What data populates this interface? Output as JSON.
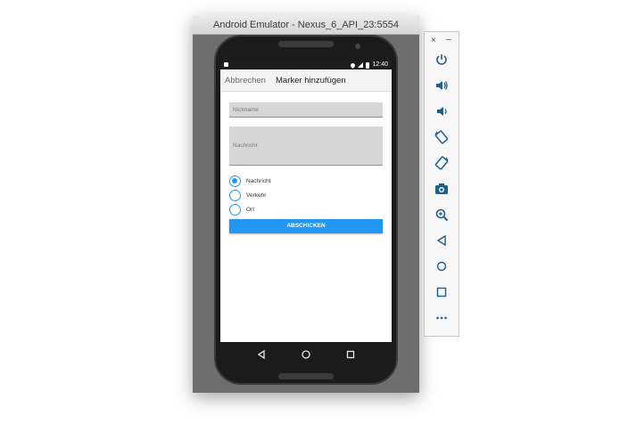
{
  "window": {
    "title": "Android Emulator - Nexus_6_API_23:5554"
  },
  "status_bar": {
    "time": "12:40"
  },
  "app_bar": {
    "cancel_label": "Abbrechen",
    "title": "Marker hinzufügen"
  },
  "form": {
    "nickname_placeholder": "Nickname",
    "message_placeholder": "Nachricht",
    "radio_options": [
      {
        "label": "Nachricht",
        "checked": true
      },
      {
        "label": "Verkehr",
        "checked": false
      },
      {
        "label": "Ort",
        "checked": false
      }
    ],
    "submit_label": "ABSCHICKEN"
  },
  "sidebar": {
    "close_label": "×",
    "minimize_label": "–",
    "buttons": [
      "power-icon",
      "volume-up-icon",
      "volume-down-icon",
      "rotate-left-icon",
      "rotate-right-icon",
      "camera-icon",
      "zoom-icon",
      "back-icon",
      "home-icon",
      "overview-icon",
      "more-icon"
    ]
  },
  "colors": {
    "accent": "#2196f3",
    "toolbar_icon": "#1f5f8b"
  }
}
